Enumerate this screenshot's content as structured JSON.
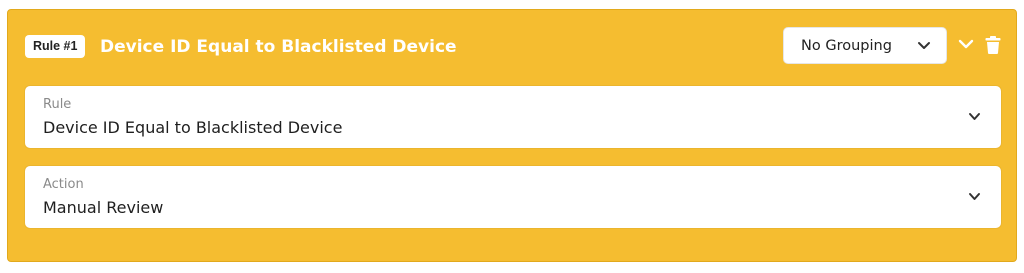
{
  "rule": {
    "badge": "Rule #1",
    "title": "Device ID Equal to Blacklisted Device",
    "accent_color": "#f5bd30",
    "grouping": {
      "selected": "No Grouping",
      "icon": "chevron-down-icon"
    },
    "header_actions": {
      "collapse_icon": "chevron-down-icon",
      "delete_icon": "trash-icon"
    },
    "fields": {
      "rule_field": {
        "label": "Rule",
        "value": "Device ID Equal to Blacklisted Device"
      },
      "action_field": {
        "label": "Action",
        "value": "Manual Review"
      }
    }
  }
}
